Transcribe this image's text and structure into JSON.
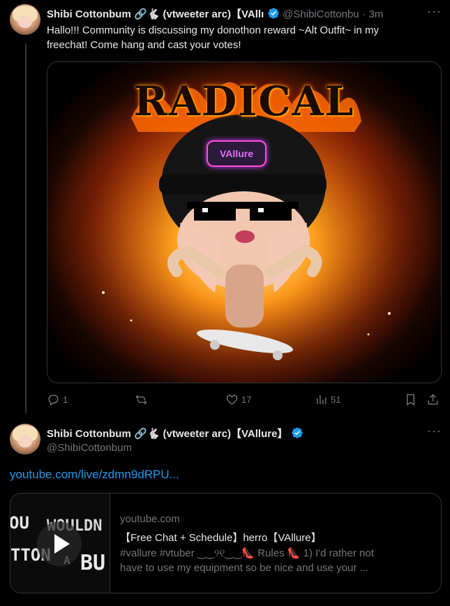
{
  "tweet1": {
    "author_name": "Shibi Cottonbum 🔗🐇 (vtweeter arc)【VAllı",
    "handle": "@ShibiCottonbu",
    "separator": "·",
    "time": "3m",
    "text_line1": "Hallo!!! Community is discussing my donothon reward ~Alt Outfit~ in my",
    "text_line2": "freechat! Come hang and cast your votes!",
    "image_title": "RADICAL",
    "image_badge": "VAllure",
    "actions": {
      "reply_count": "1",
      "retweet_count": "",
      "like_count": "17",
      "views_count": "51"
    }
  },
  "tweet2": {
    "author_name": "Shibi Cottonbum 🔗🐇 (vtweeter arc)【VAllure】",
    "handle": "@ShibiCottonbum",
    "link_text": "youtube.com/live/zdmn9dRPU...",
    "card": {
      "domain": "youtube.com",
      "title": "【Free Chat + Schedule】herro【VAllure】",
      "desc_line1": "#vallure #vtuber ‿‿୨୧‿‿👠 Rules 👠 1) I'd rather not",
      "desc_line2": "have to use my equipment so be nice and use your ...",
      "thumb_text_a": "OU",
      "thumb_text_b": "WOULDN",
      "thumb_text_c": "TTON",
      "thumb_text_d": "A",
      "thumb_text_e": "BU"
    }
  },
  "more_label": "···",
  "colors": {
    "background": "#000000",
    "text": "#e7e9ea",
    "muted": "#71767b",
    "link": "#1d9bf0",
    "verified": "#1d9bf0",
    "border": "#2f3336"
  },
  "icons": [
    "reply-icon",
    "retweet-icon",
    "like-icon",
    "views-icon",
    "bookmark-icon",
    "share-icon",
    "verified-badge-icon",
    "play-icon",
    "more-icon"
  ]
}
